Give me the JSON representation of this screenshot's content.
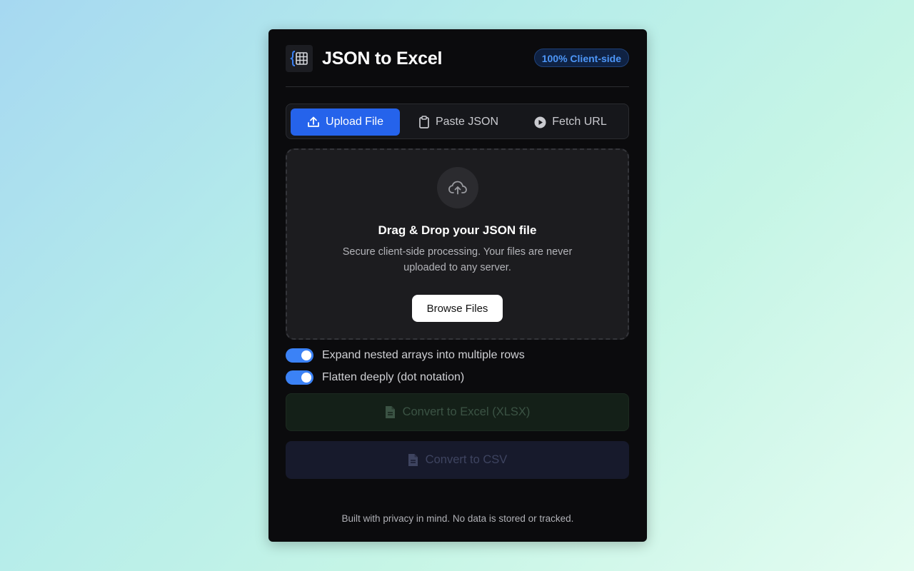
{
  "app": {
    "title": "JSON to Excel",
    "badge": "100% Client-side"
  },
  "tabs": [
    {
      "label": "Upload File",
      "icon": "upload-icon",
      "active": true
    },
    {
      "label": "Paste JSON",
      "icon": "clipboard-icon",
      "active": false
    },
    {
      "label": "Fetch URL",
      "icon": "play-circle-icon",
      "active": false
    }
  ],
  "dropzone": {
    "icon": "cloud-upload-icon",
    "title": "Drag & Drop your JSON file",
    "description": "Secure client-side processing. Your files are never uploaded to any server.",
    "browse_label": "Browse Files"
  },
  "options": [
    {
      "label": "Expand nested arrays into multiple rows",
      "enabled": true
    },
    {
      "label": "Flatten deeply (dot notation)",
      "enabled": true
    }
  ],
  "actions": {
    "xlsx_label": "Convert to Excel (XLSX)",
    "csv_label": "Convert to CSV"
  },
  "footer": "Built with privacy in mind. No data is stored or tracked.",
  "colors": {
    "accent": "#2563eb",
    "toggle": "#3b82f6",
    "badge_text": "#4d96f7",
    "panel_bg": "#0b0b0d"
  }
}
